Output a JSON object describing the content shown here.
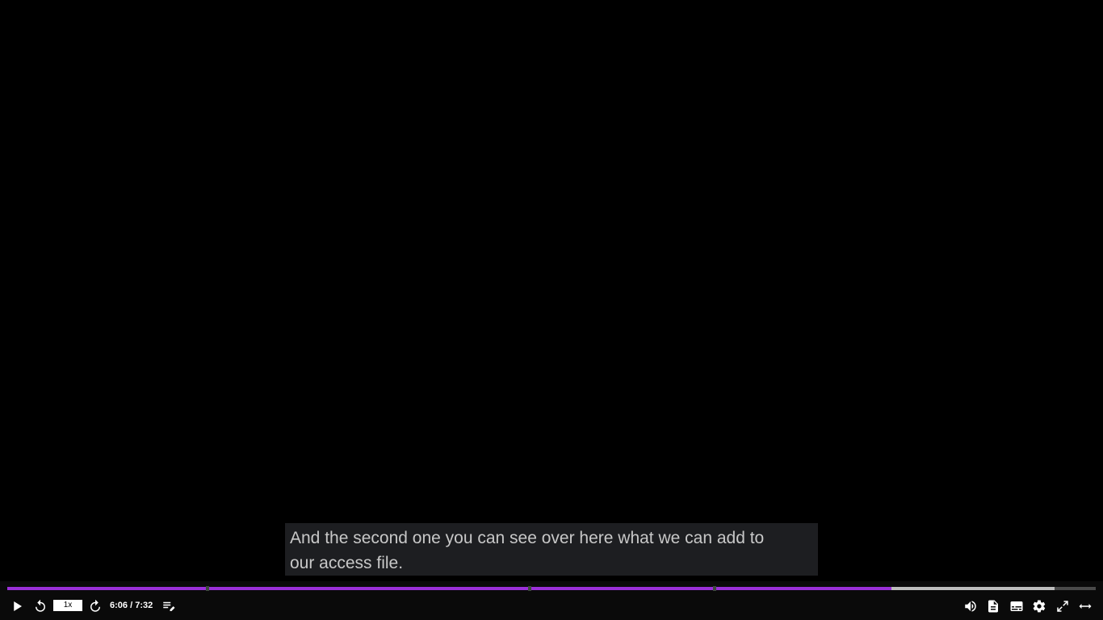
{
  "caption": {
    "line1": "And the second one you can see over here what we can add to",
    "line2": "our access file."
  },
  "playback": {
    "current_time": "6:06",
    "separator": " / ",
    "duration": "7:32",
    "speed_label": "1x",
    "played_fraction": 0.812,
    "buffered_fraction": 0.962,
    "chapter_marker_fractions": [
      0.184,
      0.48,
      0.65
    ]
  },
  "colors": {
    "accent": "#9b30d9",
    "buffered": "#bdbdbd",
    "track": "#4a4a4a"
  },
  "icons": {
    "play": "play-icon",
    "rewind": "rewind-10-icon",
    "forward": "forward-10-icon",
    "notes": "playlist-edit-icon",
    "volume": "volume-icon",
    "transcript": "transcript-icon",
    "captions": "captions-icon",
    "settings": "gear-icon",
    "fullscreen": "fullscreen-icon",
    "expand": "expand-width-icon"
  }
}
